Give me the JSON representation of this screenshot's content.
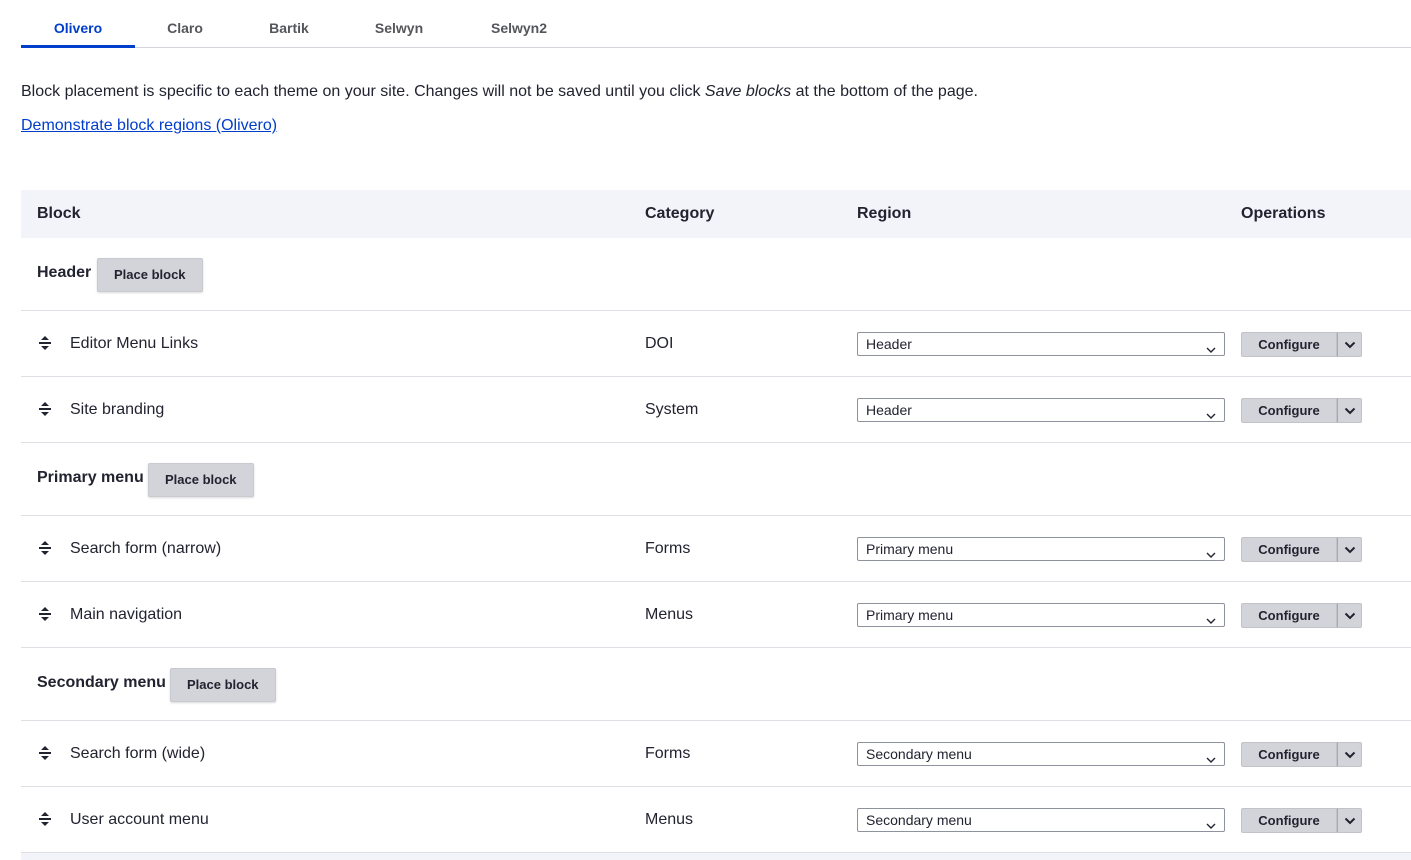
{
  "tabs": [
    {
      "label": "Olivero",
      "active": true
    },
    {
      "label": "Claro",
      "active": false
    },
    {
      "label": "Bartik",
      "active": false
    },
    {
      "label": "Selwyn",
      "active": false
    },
    {
      "label": "Selwyn2",
      "active": false
    }
  ],
  "intro": {
    "text_before": "Block placement is specific to each theme on your site. Changes will not be saved until you click ",
    "emphasis": "Save blocks",
    "text_after": " at the bottom of the page."
  },
  "demo_link": "Demonstrate block regions (Olivero)",
  "table": {
    "headers": {
      "block": "Block",
      "category": "Category",
      "region": "Region",
      "operations": "Operations"
    },
    "place_block_label": "Place block",
    "configure_label": "Configure",
    "regions": [
      {
        "title": "Header",
        "blocks": [
          {
            "name": "Editor Menu Links",
            "category": "DOI",
            "region": "Header"
          },
          {
            "name": "Site branding",
            "category": "System",
            "region": "Header"
          }
        ]
      },
      {
        "title": "Primary menu",
        "blocks": [
          {
            "name": "Search form (narrow)",
            "category": "Forms",
            "region": "Primary menu"
          },
          {
            "name": "Main navigation",
            "category": "Menus",
            "region": "Primary menu"
          }
        ]
      },
      {
        "title": "Secondary menu",
        "blocks": [
          {
            "name": "Search form (wide)",
            "category": "Forms",
            "region": "Secondary menu"
          },
          {
            "name": "User account menu",
            "category": "Menus",
            "region": "Secondary menu"
          }
        ]
      }
    ]
  },
  "colors": {
    "accent": "#003ecc",
    "header_bg": "#f3f4f9",
    "button_bg": "#d3d4d9"
  }
}
